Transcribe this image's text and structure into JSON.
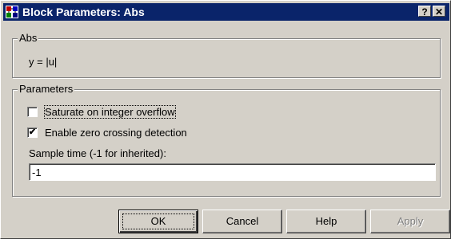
{
  "window": {
    "title": "Block Parameters: Abs",
    "help_glyph": "?",
    "close_glyph": "✕"
  },
  "block": {
    "group_label": "Abs",
    "description": "y = |u|"
  },
  "parameters": {
    "group_label": "Parameters",
    "saturate": {
      "label": "Saturate on integer overflow",
      "checked": false
    },
    "zero_crossing": {
      "label": "Enable zero crossing detection",
      "checked": true,
      "mark": "✔"
    },
    "sample_time_label": "Sample time (-1 for inherited):",
    "sample_time_value": "-1"
  },
  "buttons": {
    "ok": "OK",
    "cancel": "Cancel",
    "help": "Help",
    "apply": "Apply"
  },
  "colors": {
    "titlebar": "#0a246a",
    "face": "#d4d0c8"
  }
}
